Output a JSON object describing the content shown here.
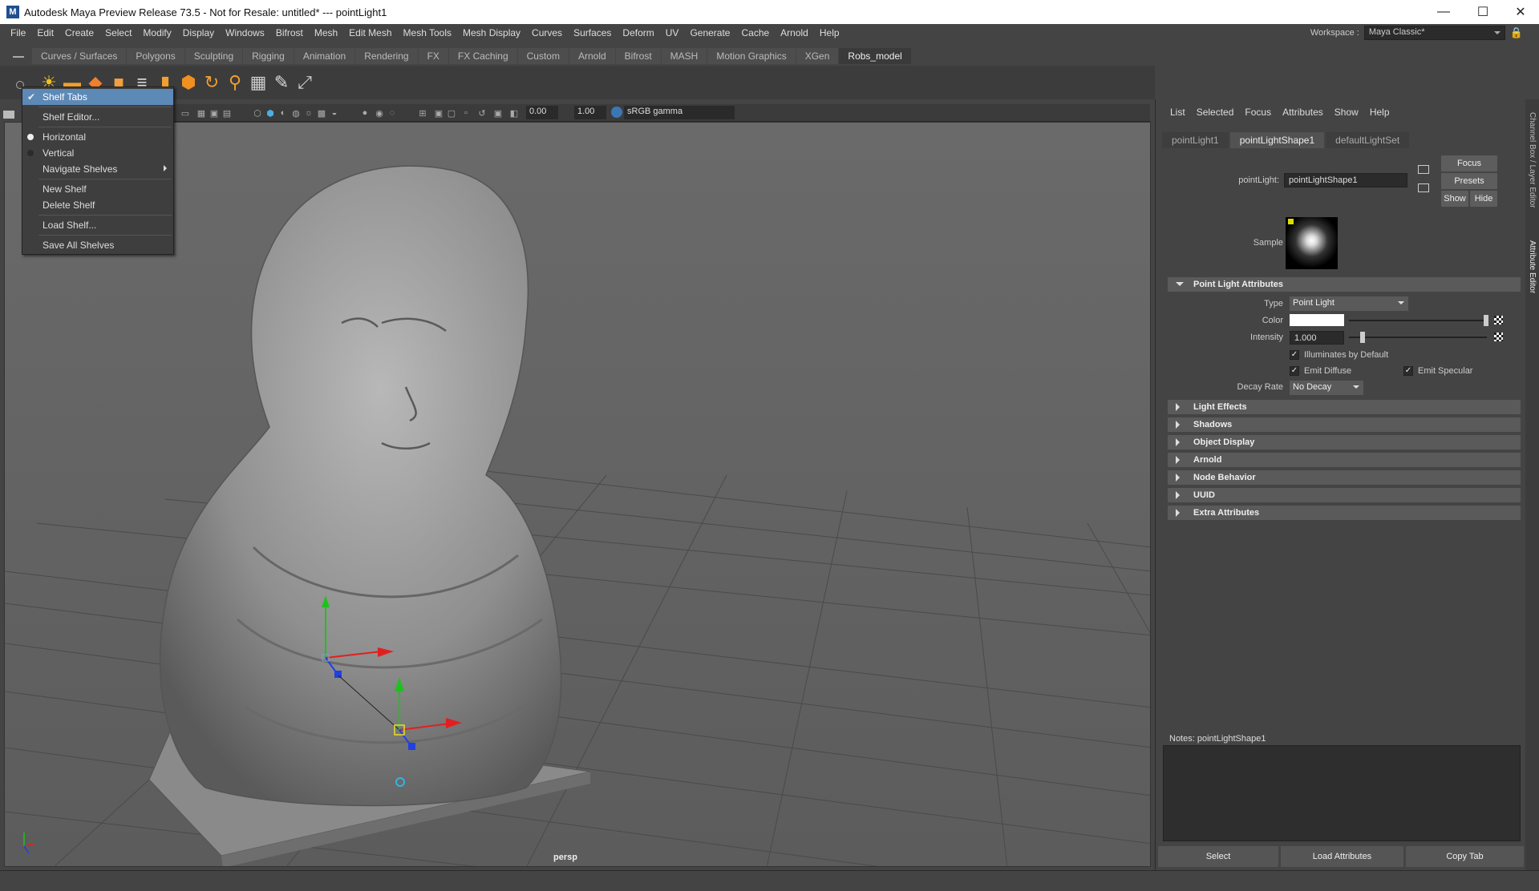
{
  "window": {
    "title": "Autodesk Maya Preview Release 73.5 - Not for Resale: untitled*   ---   pointLight1",
    "logo": "M",
    "minimize_glyph": "—",
    "maximize_glyph": "☐",
    "close_glyph": "✕"
  },
  "menubar": [
    "File",
    "Edit",
    "Create",
    "Select",
    "Modify",
    "Display",
    "Windows",
    "Bifrost",
    "Mesh",
    "Edit Mesh",
    "Mesh Tools",
    "Mesh Display",
    "Curves",
    "Surfaces",
    "Deform",
    "UV",
    "Generate",
    "Cache",
    "Arnold",
    "Help"
  ],
  "workspace": {
    "label": "Workspace :",
    "value": "Maya Classic*"
  },
  "shelf_tabs": [
    "Curves / Surfaces",
    "Polygons",
    "Sculpting",
    "Rigging",
    "Animation",
    "Rendering",
    "FX",
    "FX Caching",
    "Custom",
    "Arnold",
    "Bifrost",
    "MASH",
    "Motion Graphics",
    "XGen",
    "Robs_model"
  ],
  "shelf_active_tab": "Robs_model",
  "shelf_icons": [
    "sun-light-icon",
    "area-light-icon",
    "diamond-icon",
    "cube-icon",
    "layers-icon",
    "cylinder-icon",
    "box-icon",
    "rotate-icon",
    "joint-icon",
    "grid-icon",
    "pen-icon",
    "transform-icon"
  ],
  "viewport_toolbar": {
    "exposure": "0.00",
    "gamma": "1.00",
    "color_space": "sRGB gamma"
  },
  "viewport_label": "persp",
  "shelf_menu": {
    "items": [
      {
        "label": "Shelf Tabs",
        "checked": true,
        "highlighted": true
      },
      {
        "label": "Shelf Editor..."
      },
      {
        "label": "Horizontal",
        "radio": true,
        "selected": true
      },
      {
        "label": "Vertical",
        "radio": true,
        "selected": false
      },
      {
        "label": "Navigate Shelves",
        "submenu": true
      },
      {
        "label": "New Shelf"
      },
      {
        "label": "Delete Shelf"
      },
      {
        "label": "Load Shelf..."
      },
      {
        "label": "Save All Shelves"
      }
    ]
  },
  "attribute_editor": {
    "menu": [
      "List",
      "Selected",
      "Focus",
      "Attributes",
      "Show",
      "Help"
    ],
    "tabs": [
      "pointLight1",
      "pointLightShape1",
      "defaultLightSet"
    ],
    "active_tab": "pointLightShape1",
    "node_label": "pointLight:",
    "node_value": "pointLightShape1",
    "buttons": {
      "focus": "Focus",
      "presets": "Presets",
      "show": "Show",
      "hide": "Hide"
    },
    "sample_label": "Sample",
    "section_open": "Point Light Attributes",
    "type_label": "Type",
    "type_value": "Point Light",
    "color_label": "Color",
    "intensity_label": "Intensity",
    "intensity_value": "1.000",
    "illuminates_label": "Illuminates by Default",
    "emit_diffuse_label": "Emit Diffuse",
    "emit_specular_label": "Emit Specular",
    "decay_label": "Decay Rate",
    "decay_value": "No Decay",
    "sections_closed": [
      "Light Effects",
      "Shadows",
      "Object Display",
      "Arnold",
      "Node Behavior",
      "UUID",
      "Extra Attributes"
    ],
    "notes_label": "Notes:  pointLightShape1",
    "bottom_buttons": [
      "Select",
      "Load Attributes",
      "Copy Tab"
    ]
  },
  "side_tabs": {
    "channel": "Channel Box / Layer Editor",
    "attr": "Attribute Editor"
  },
  "colors": {
    "highlight": "#5d89b6",
    "axis_x": "#e02020",
    "axis_y": "#20c020",
    "axis_z": "#2040e0"
  }
}
